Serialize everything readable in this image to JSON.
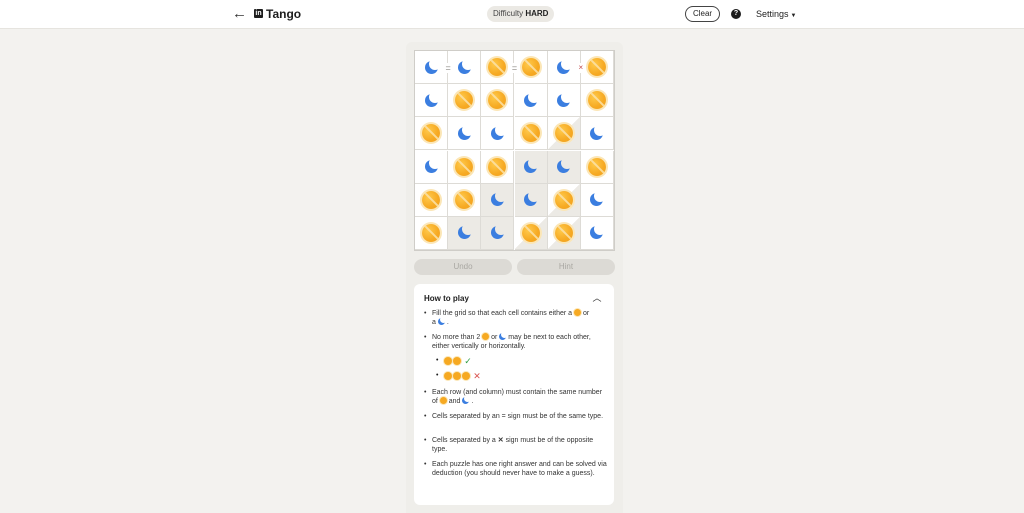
{
  "header": {
    "back_icon": "arrow-left-icon",
    "logo_text": "in",
    "title": "Tango",
    "difficulty_label": "Difficulty",
    "difficulty_value": "HARD",
    "clear_label": "Clear",
    "help_label": "?",
    "settings_label": "Settings"
  },
  "board": {
    "size": 6,
    "cells": [
      [
        "moon",
        "moon",
        "sun",
        "sun",
        "moon",
        "sun"
      ],
      [
        "moon",
        "sun",
        "sun",
        "moon",
        "moon",
        "sun"
      ],
      [
        "sun",
        "moon",
        "moon",
        "sun",
        "sun",
        "moon"
      ],
      [
        "moon",
        "sun",
        "sun",
        "moon",
        "moon",
        "sun"
      ],
      [
        "sun",
        "sun",
        "moon",
        "moon",
        "sun",
        "moon"
      ],
      [
        "sun",
        "moon",
        "moon",
        "sun",
        "sun",
        "moon"
      ]
    ],
    "shaded": [
      [
        0,
        0,
        0,
        0,
        0,
        0
      ],
      [
        0,
        0,
        0,
        0,
        0,
        0
      ],
      [
        0,
        0,
        0,
        0,
        2,
        0
      ],
      [
        0,
        0,
        0,
        1,
        1,
        0
      ],
      [
        0,
        0,
        1,
        1,
        2,
        0
      ],
      [
        0,
        1,
        1,
        2,
        2,
        0
      ]
    ],
    "signs": [
      {
        "row": 0,
        "col": 0,
        "dir": "right",
        "type": "equal",
        "symbol": "="
      },
      {
        "row": 0,
        "col": 2,
        "dir": "right",
        "type": "equal",
        "symbol": "="
      },
      {
        "row": 0,
        "col": 4,
        "dir": "right",
        "type": "cross",
        "symbol": "×"
      }
    ],
    "colors": {
      "sun": "#f6a922",
      "moon": "#3b7ee0",
      "locked": "#eceae5"
    }
  },
  "controls": {
    "undo_label": "Undo",
    "hint_label": "Hint"
  },
  "howto": {
    "title": "How to play",
    "collapse_icon": "chevron-up-icon",
    "rule1_a": "Fill the grid so that each cell contains either a",
    "rule1_b": "or",
    "rule1_c": "a",
    "rule1_d": ".",
    "rule2_a": "No more than 2",
    "rule2_b": "or",
    "rule2_c": "may be next to each other, either vertically or horizontally.",
    "example_ok": "✓",
    "example_bad": "✕",
    "rule3_a": "Each row (and column) must contain the same number of",
    "rule3_b": "and",
    "rule3_c": ".",
    "rule4": "Cells separated by an = sign must be of the same type.",
    "rule5_a": "Cells separated by a",
    "rule5_sym": "✕",
    "rule5_b": "sign must be of the opposite type.",
    "rule6": "Each puzzle has one right answer and can be solved via deduction (you should never have to make a guess)."
  }
}
